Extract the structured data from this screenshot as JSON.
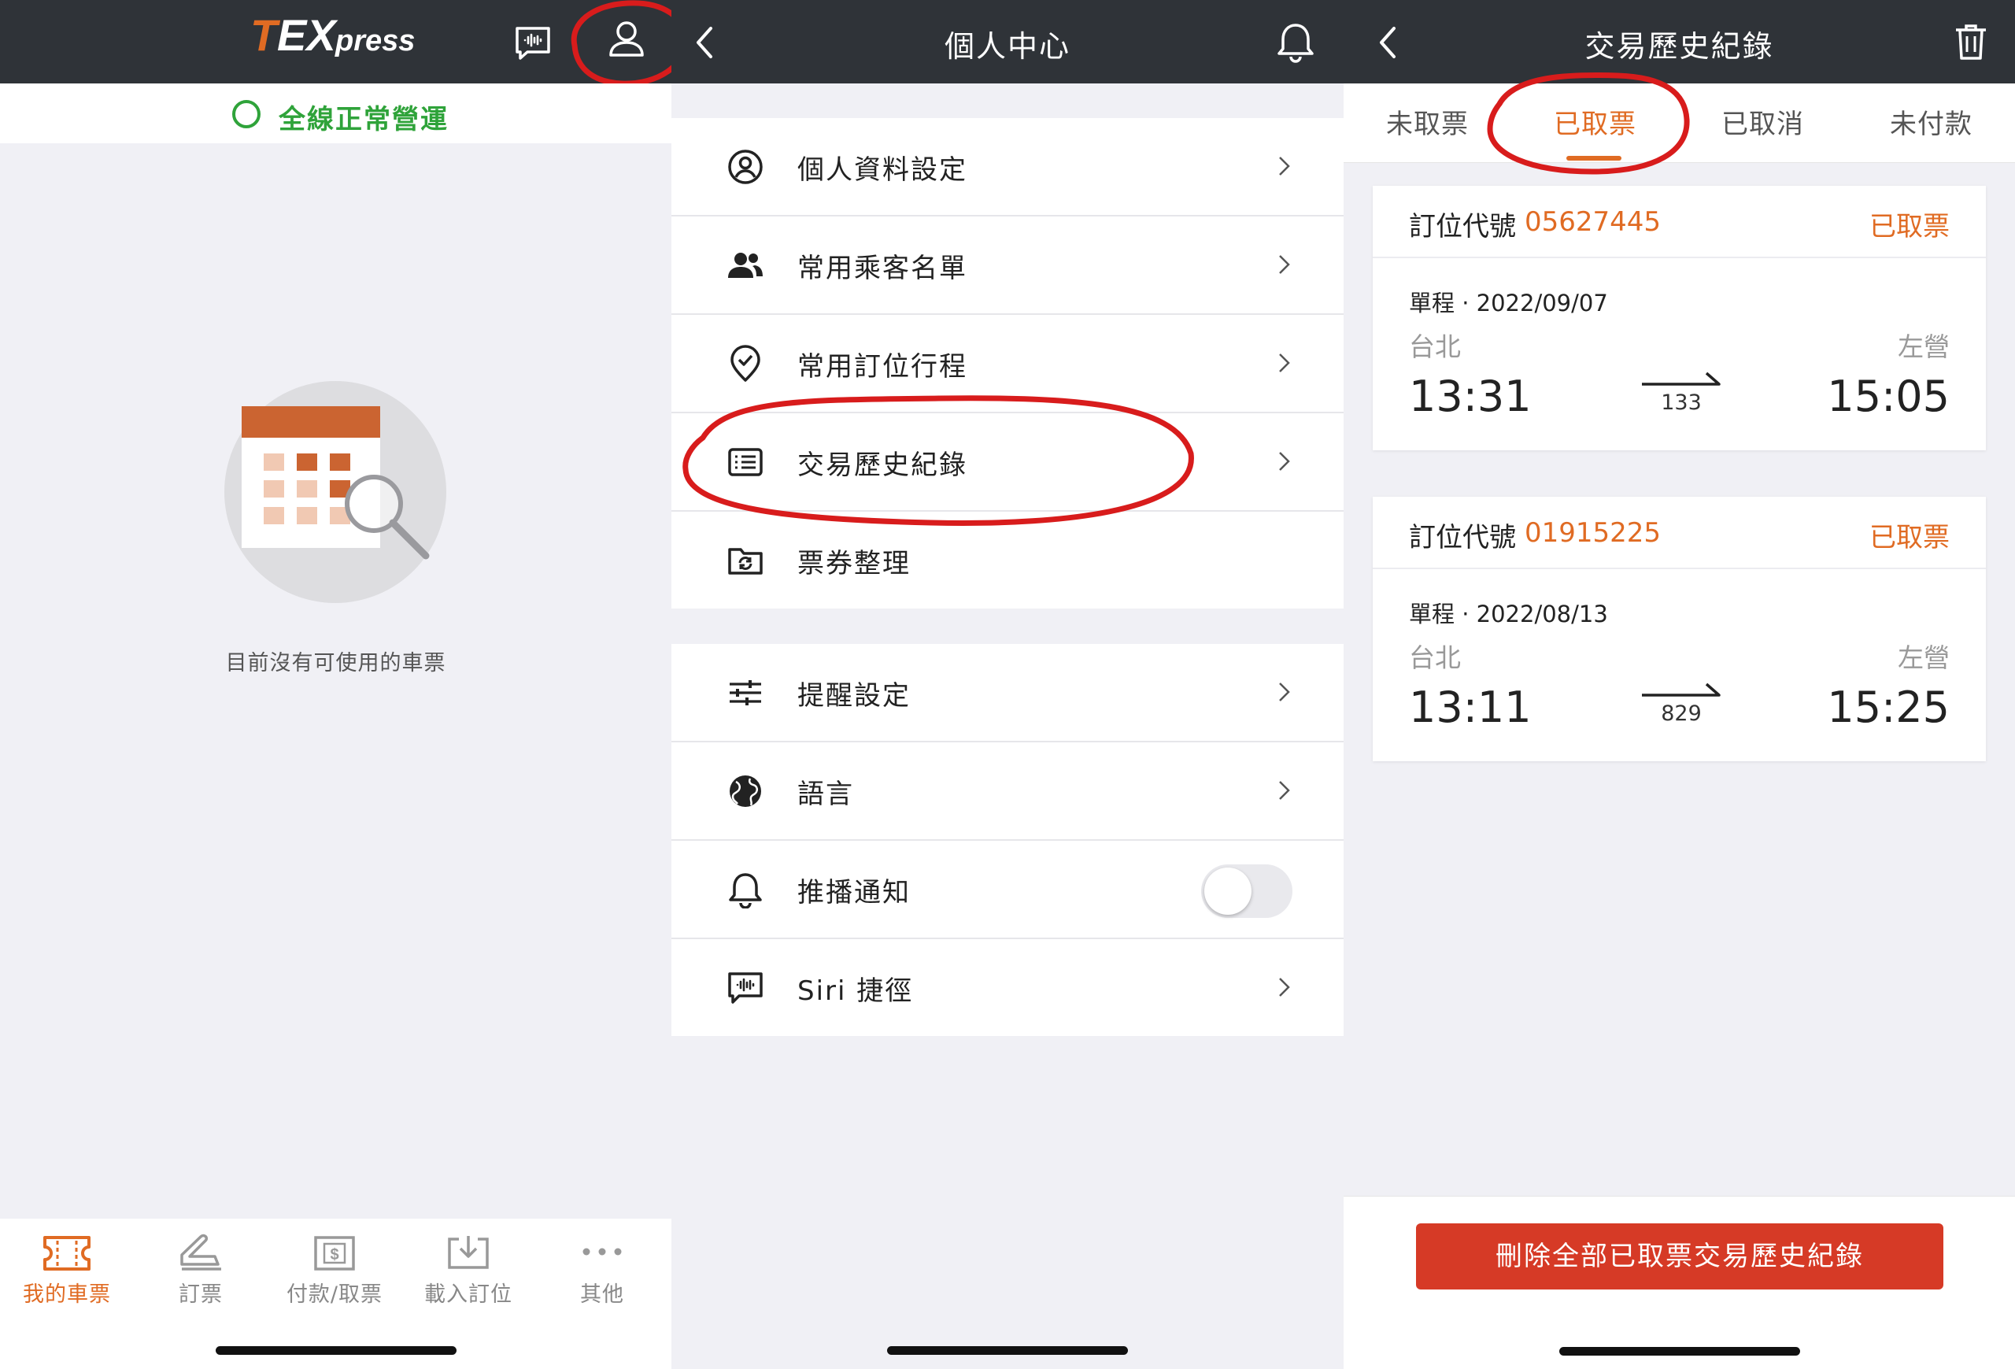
{
  "colors": {
    "accent": "#e06b23",
    "ok_green": "#2fa33a",
    "header": "#2f3338",
    "annotation_red": "#d81c1c",
    "delete_red": "#d63a26"
  },
  "panel1": {
    "logo": {
      "t": "T",
      "ex": "EX",
      "press": "press"
    },
    "status_text": "全線正常營運",
    "empty_text": "目前沒有可使用的車票",
    "tabs": [
      {
        "label": "我的車票",
        "icon": "ticket-icon",
        "active": true
      },
      {
        "label": "訂票",
        "icon": "seat-icon",
        "active": false
      },
      {
        "label": "付款/取票",
        "icon": "payment-icon",
        "active": false
      },
      {
        "label": "載入訂位",
        "icon": "download-icon",
        "active": false
      },
      {
        "label": "其他",
        "icon": "more-icon",
        "active": false
      }
    ]
  },
  "panel2": {
    "title": "個人中心",
    "group1": [
      {
        "label": "個人資料設定",
        "icon": "profile-icon"
      },
      {
        "label": "常用乘客名單",
        "icon": "people-icon"
      },
      {
        "label": "常用訂位行程",
        "icon": "pin-check-icon"
      },
      {
        "label": "交易歷史紀錄",
        "icon": "list-icon"
      },
      {
        "label": "票券整理",
        "icon": "folder-sync-icon"
      }
    ],
    "group2": [
      {
        "label": "提醒設定",
        "icon": "sliders-icon"
      },
      {
        "label": "語言",
        "icon": "globe-icon"
      },
      {
        "label": "推播通知",
        "icon": "bell-icon",
        "toggle": false
      },
      {
        "label": "Siri 捷徑",
        "icon": "siri-icon"
      }
    ]
  },
  "panel3": {
    "title": "交易歷史紀錄",
    "tabs": [
      {
        "label": "未取票",
        "active": false
      },
      {
        "label": "已取票",
        "active": true
      },
      {
        "label": "已取消",
        "active": false
      },
      {
        "label": "未付款",
        "active": false
      }
    ],
    "cards": [
      {
        "pnr_label": "訂位代號",
        "pnr": "05627445",
        "status": "已取票",
        "trip": "單程 · 2022/09/07",
        "from": "台北",
        "to": "左營",
        "dep": "13:31",
        "arr": "15:05",
        "train": "133"
      },
      {
        "pnr_label": "訂位代號",
        "pnr": "01915225",
        "status": "已取票",
        "trip": "單程 · 2022/08/13",
        "from": "台北",
        "to": "左營",
        "dep": "13:11",
        "arr": "15:25",
        "train": "829"
      }
    ],
    "delete_button": "刪除全部已取票交易歷史紀錄"
  }
}
